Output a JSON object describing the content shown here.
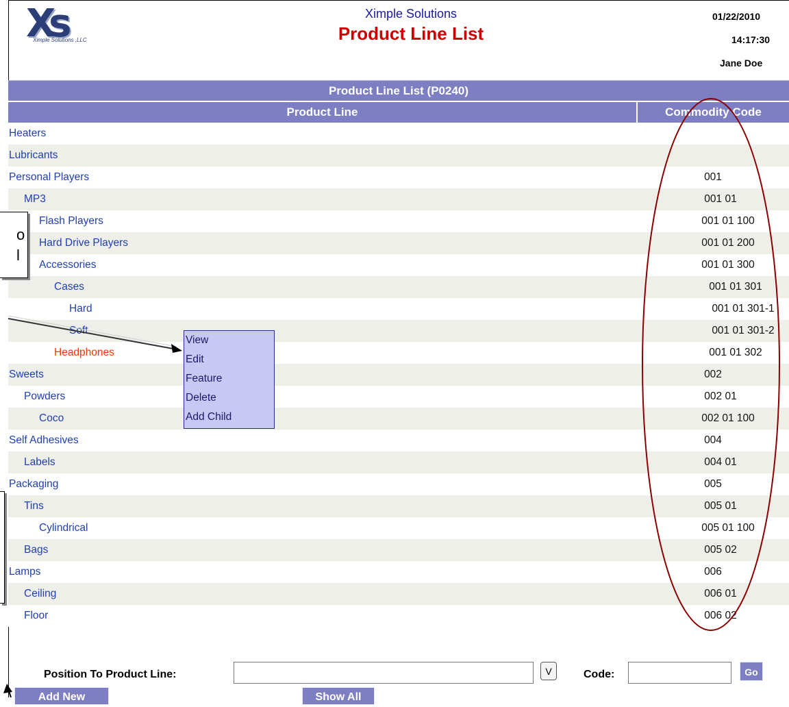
{
  "header": {
    "logo_mark": "Xs",
    "logo_sub": "Ximple Solutions ,LLC",
    "company": "Ximple Solutions",
    "title": "Product Line List",
    "date": "01/22/2010",
    "time": "14:17:30",
    "user": "Jane Doe"
  },
  "grid": {
    "title": "Product Line List (P0240)",
    "col_product_line": "Product Line",
    "col_commodity_code": "Commodity Code",
    "rows": [
      {
        "name": "Heaters",
        "level": 0,
        "code": ""
      },
      {
        "name": "Lubricants",
        "level": 0,
        "code": ""
      },
      {
        "name": "Personal Players",
        "level": 0,
        "code": "001"
      },
      {
        "name": "MP3",
        "level": 1,
        "code": "001 01"
      },
      {
        "name": "Flash Players",
        "level": 2,
        "code": "001 01 100"
      },
      {
        "name": "Hard Drive Players",
        "level": 2,
        "code": "001 01 200"
      },
      {
        "name": "Accessories",
        "level": 2,
        "code": "001 01 300"
      },
      {
        "name": "Cases",
        "level": 3,
        "code": "001 01 301"
      },
      {
        "name": "Hard",
        "level": 4,
        "code": "001 01 301-1"
      },
      {
        "name": "Soft",
        "level": 4,
        "code": "001 01 301-2"
      },
      {
        "name": "Headphones",
        "level": 3,
        "code": "001 01 302",
        "selected": true
      },
      {
        "name": "Sweets",
        "level": 0,
        "code": "002"
      },
      {
        "name": "Powders",
        "level": 1,
        "code": "002 01"
      },
      {
        "name": "Coco",
        "level": 2,
        "code": "002 01 100"
      },
      {
        "name": "Self Adhesives",
        "level": 0,
        "code": "004"
      },
      {
        "name": "Labels",
        "level": 1,
        "code": "004 01"
      },
      {
        "name": "Packaging",
        "level": 0,
        "code": "005"
      },
      {
        "name": "Tins",
        "level": 1,
        "code": "005 01"
      },
      {
        "name": "Cylindrical",
        "level": 2,
        "code": "005 01 100"
      },
      {
        "name": "Bags",
        "level": 1,
        "code": "005 02"
      },
      {
        "name": "Lamps",
        "level": 0,
        "code": "006"
      },
      {
        "name": "Ceiling",
        "level": 1,
        "code": "006 01"
      },
      {
        "name": "Floor",
        "level": 1,
        "code": "006 02"
      }
    ]
  },
  "context_menu": [
    "View",
    "Edit",
    "Feature",
    "Delete",
    "Add Child"
  ],
  "callout_fragments": [
    "o",
    "l"
  ],
  "footer": {
    "position_label": "Position To Product Line:",
    "position_value": "",
    "v_button": "V",
    "code_label": "Code:",
    "code_value": "",
    "go_button": "Go",
    "add_new": "Add New",
    "show_all": "Show All"
  },
  "colors": {
    "header_bg": "#7e7ec2",
    "link": "#1f3fb0",
    "selected": "#ff3300",
    "title_red": "#cc0000",
    "annotation": "#8b0000"
  }
}
